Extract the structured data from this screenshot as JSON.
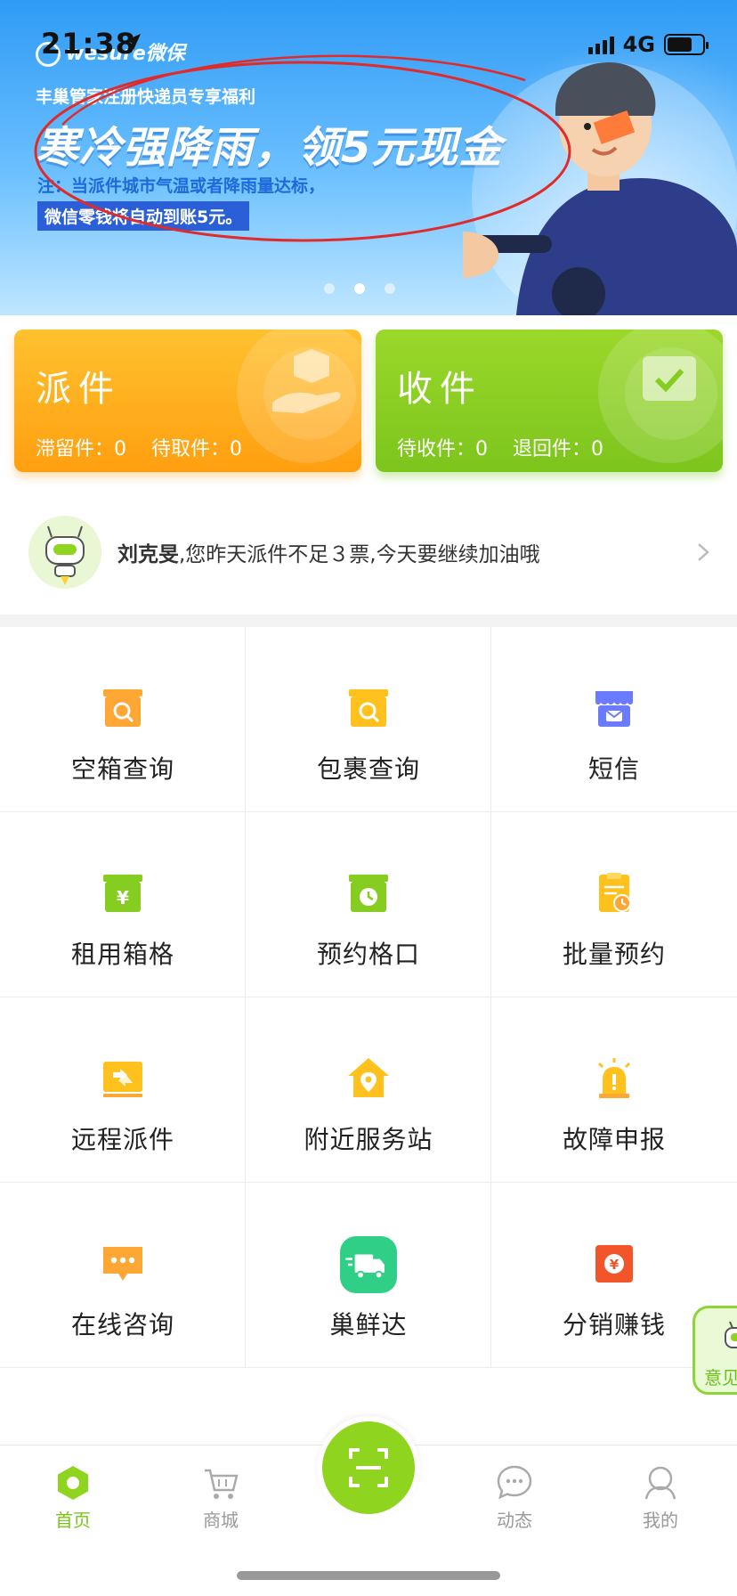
{
  "status_bar": {
    "time": "21:38",
    "network": "4G"
  },
  "banner": {
    "brand": "wesure微保",
    "subtitle": "丰巢管家注册快递员专享福利",
    "title": "寒冷强降雨，领5元现金",
    "note_line1": "注：当派件城市气温或者降雨量达标，",
    "note_line2": "微信零钱将自动到账5元。",
    "carousel_active_index": 1,
    "carousel_count": 3
  },
  "cards": {
    "send": {
      "title": "派件",
      "stat1": "滞留件：0",
      "stat2": "待取件：0",
      "color": "#ffab1c"
    },
    "receive": {
      "title": "收件",
      "stat1": "待收件：0",
      "stat2": "退回件：0",
      "color": "#86cd22"
    }
  },
  "notice": {
    "name": "刘克旻",
    "message": ",您昨天派件不足３票,今天要继续加油哦"
  },
  "grid": [
    {
      "label": "空箱查询",
      "icon": "box-search-icon"
    },
    {
      "label": "包裹查询",
      "icon": "package-search-icon"
    },
    {
      "label": "短信",
      "icon": "sms-store-icon"
    },
    {
      "label": "租用箱格",
      "icon": "rent-box-icon"
    },
    {
      "label": "预约格口",
      "icon": "reserve-slot-icon"
    },
    {
      "label": "批量预约",
      "icon": "batch-reserve-icon"
    },
    {
      "label": "远程派件",
      "icon": "remote-delivery-icon"
    },
    {
      "label": "附近服务站",
      "icon": "nearby-station-icon"
    },
    {
      "label": "故障申报",
      "icon": "fault-report-icon"
    },
    {
      "label": "在线咨询",
      "icon": "online-consult-icon"
    },
    {
      "label": "巢鲜达",
      "icon": "fresh-truck-icon"
    },
    {
      "label": "分销赚钱",
      "icon": "distribution-money-icon"
    }
  ],
  "feedback": {
    "label": "意见"
  },
  "tabbar": {
    "home": "首页",
    "mall": "商城",
    "feed": "动态",
    "mine": "我的"
  },
  "colors": {
    "accent": "#7cc51d",
    "orange": "#ffab1c",
    "blue": "#2f9bf5"
  }
}
